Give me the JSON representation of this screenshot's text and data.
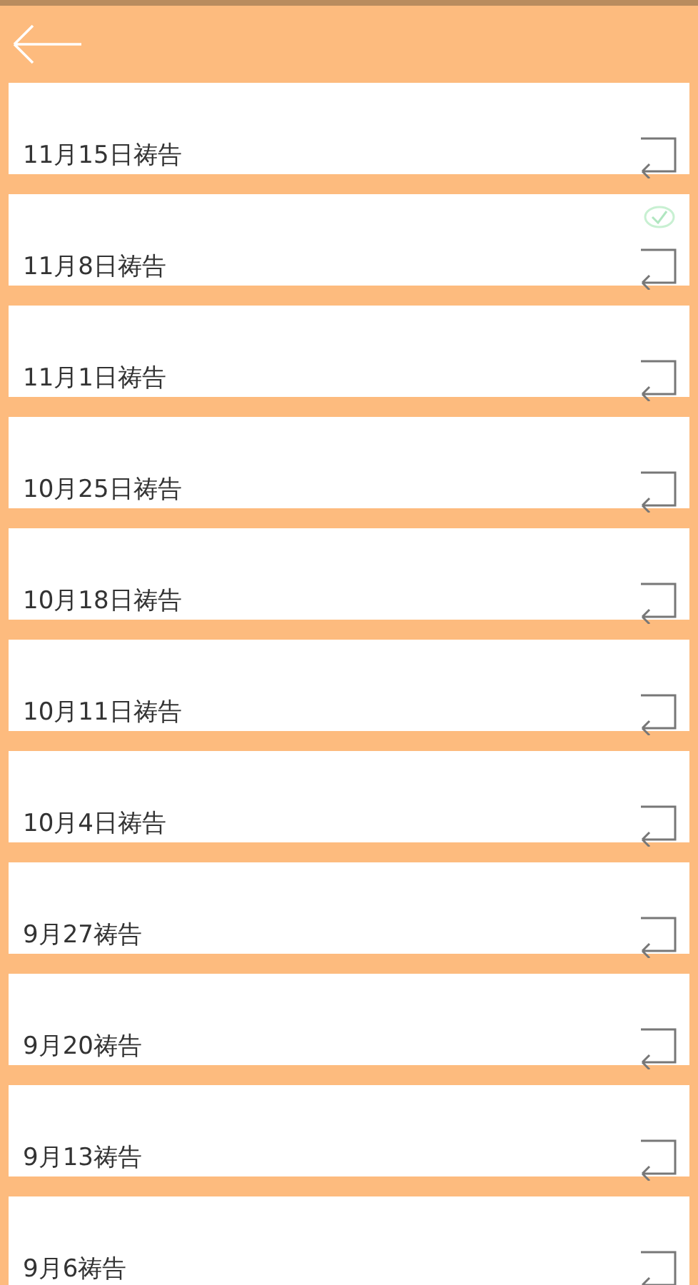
{
  "items": [
    {
      "title": "11月15日祷告",
      "checked": false
    },
    {
      "title": "11月8日祷告",
      "checked": true
    },
    {
      "title": "11月1日祷告",
      "checked": false
    },
    {
      "title": "10月25日祷告",
      "checked": false
    },
    {
      "title": "10月18日祷告",
      "checked": false
    },
    {
      "title": "10月11日祷告",
      "checked": false
    },
    {
      "title": "10月4日祷告",
      "checked": false
    },
    {
      "title": "9月27祷告",
      "checked": false
    },
    {
      "title": "9月20祷告",
      "checked": false
    },
    {
      "title": "9月13祷告",
      "checked": false
    },
    {
      "title": "9月6祷告",
      "checked": false
    }
  ]
}
